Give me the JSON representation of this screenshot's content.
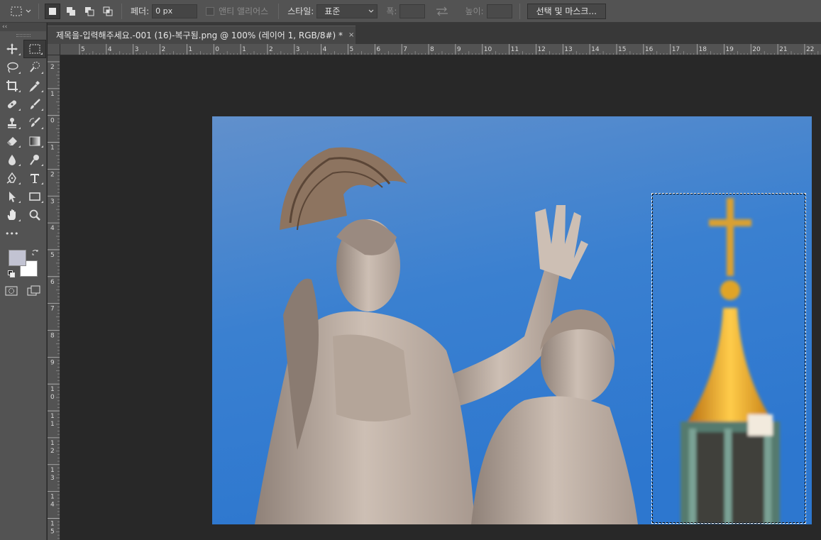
{
  "options_bar": {
    "feather_label": "페더:",
    "feather_value": "0 px",
    "antialias_label": "앤티 앨리어스",
    "style_label": "스타일:",
    "style_value": "표준",
    "width_label": "폭:",
    "height_label": "높이:",
    "select_mask_button": "선택 및 마스크..."
  },
  "document": {
    "tab_title": "제목을-입력해주세요.-001 (16)-복구됨.png @ 100% (레이어 1, RGB/8#) *",
    "close_glyph": "×"
  },
  "toolbar": {
    "collapse_glyph": "‹‹",
    "edit_toolbar_glyph": "•••",
    "foreground_color": "#c2c3d2",
    "background_color": "#ffffff",
    "tools": [
      {
        "name": "move-tool",
        "icon": "move-icon"
      },
      {
        "name": "marquee-tool",
        "icon": "rect-marquee-icon",
        "active": true
      },
      {
        "name": "lasso-tool",
        "icon": "lasso-icon"
      },
      {
        "name": "quick-select-tool",
        "icon": "quick-select-icon"
      },
      {
        "name": "crop-tool",
        "icon": "crop-icon"
      },
      {
        "name": "eyedropper-tool",
        "icon": "eyedropper-icon"
      },
      {
        "name": "healing-brush-tool",
        "icon": "bandage-icon"
      },
      {
        "name": "brush-tool",
        "icon": "brush-icon"
      },
      {
        "name": "clone-stamp-tool",
        "icon": "stamp-icon"
      },
      {
        "name": "history-brush-tool",
        "icon": "history-brush-icon"
      },
      {
        "name": "eraser-tool",
        "icon": "eraser-icon"
      },
      {
        "name": "gradient-tool",
        "icon": "gradient-icon"
      },
      {
        "name": "blur-tool",
        "icon": "drop-icon"
      },
      {
        "name": "dodge-tool",
        "icon": "dodge-icon"
      },
      {
        "name": "pen-tool",
        "icon": "pen-icon"
      },
      {
        "name": "type-tool",
        "icon": "type-icon"
      },
      {
        "name": "path-select-tool",
        "icon": "arrow-icon"
      },
      {
        "name": "rectangle-tool",
        "icon": "rectangle-icon"
      },
      {
        "name": "hand-tool",
        "icon": "hand-icon"
      },
      {
        "name": "zoom-tool",
        "icon": "zoom-icon"
      }
    ]
  },
  "rulers": {
    "horizontal_ticks": [
      "5",
      "4",
      "3",
      "2",
      "1",
      "0",
      "1",
      "2",
      "3",
      "4",
      "5",
      "6",
      "7",
      "8",
      "9",
      "10",
      "11",
      "12",
      "13",
      "14",
      "15",
      "16",
      "17",
      "18",
      "19",
      "20",
      "21",
      "22"
    ],
    "vertical_ticks": [
      "2",
      "1",
      "0",
      "1",
      "2",
      "3",
      "4",
      "5",
      "6",
      "7",
      "8",
      "9",
      "10",
      "11",
      "12",
      "13",
      "14",
      "15"
    ]
  },
  "colors": {
    "sky_top": "#5e8ecb",
    "sky_bottom": "#2f7ad0",
    "marble": "#c9bcb2",
    "gold": "#e8a21a"
  }
}
